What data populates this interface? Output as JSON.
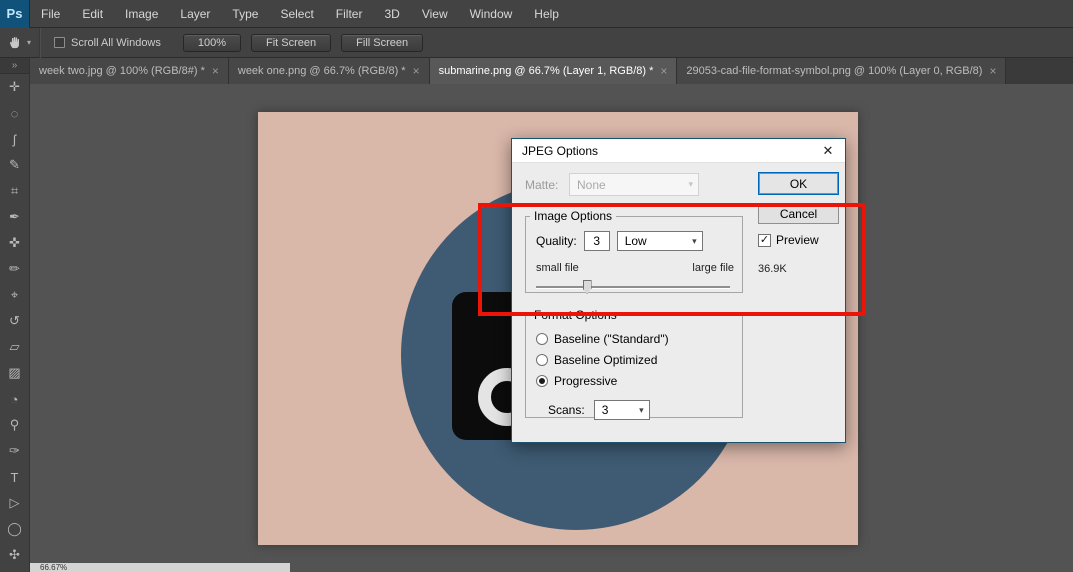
{
  "menu_bar": {
    "logo": "Ps",
    "items": [
      "File",
      "Edit",
      "Image",
      "Layer",
      "Type",
      "Select",
      "Filter",
      "3D",
      "View",
      "Window",
      "Help"
    ]
  },
  "options_bar": {
    "tool_icon": "hand-icon",
    "scroll_all_windows_label": "Scroll All Windows",
    "scroll_all_windows_checked": false,
    "buttons": [
      "100%",
      "Fit Screen",
      "Fill Screen"
    ]
  },
  "tabs": [
    {
      "label": "week two.jpg @ 100% (RGB/8#) *",
      "active": false
    },
    {
      "label": "week one.png @ 66.7% (RGB/8) *",
      "active": false
    },
    {
      "label": "submarine.png @ 66.7% (Layer 1, RGB/8) *",
      "active": true
    },
    {
      "label": "29053-cad-file-format-symbol.png @ 100% (Layer 0, RGB/8)",
      "active": false
    }
  ],
  "toolbar": {
    "tools": [
      {
        "name": "move",
        "glyph": "✛"
      },
      {
        "name": "marquee",
        "glyph": "◌"
      },
      {
        "name": "lasso",
        "glyph": "ʃ"
      },
      {
        "name": "quick-selection",
        "glyph": "✎"
      },
      {
        "name": "crop",
        "glyph": "⌗"
      },
      {
        "name": "eyedropper",
        "glyph": "✒"
      },
      {
        "name": "spot-healing",
        "glyph": "✜"
      },
      {
        "name": "brush",
        "glyph": "✏"
      },
      {
        "name": "clone-stamp",
        "glyph": "⌖"
      },
      {
        "name": "history-brush",
        "glyph": "↺"
      },
      {
        "name": "eraser",
        "glyph": "▱"
      },
      {
        "name": "gradient",
        "glyph": "▨"
      },
      {
        "name": "blur",
        "glyph": "◔"
      },
      {
        "name": "dodge",
        "glyph": "⚲"
      },
      {
        "name": "pen",
        "glyph": "✑"
      },
      {
        "name": "type",
        "glyph": "T"
      },
      {
        "name": "path-selection",
        "glyph": "▷"
      },
      {
        "name": "ellipse",
        "glyph": "◯"
      },
      {
        "name": "hand",
        "glyph": "✣"
      }
    ]
  },
  "status_bar": {
    "zoom": "66.67%"
  },
  "dialog": {
    "title": "JPEG Options",
    "matte_label": "Matte:",
    "matte_value": "None",
    "matte_disabled": true,
    "ok_label": "OK",
    "cancel_label": "Cancel",
    "image_options": {
      "legend": "Image Options",
      "quality_label": "Quality:",
      "quality_value": "3",
      "quality_name": "Low",
      "small_file": "small file",
      "large_file": "large file",
      "slider_percent": 24
    },
    "preview_label": "Preview",
    "preview_checked": true,
    "file_size": "36.9K",
    "format_options": {
      "legend": "Format Options",
      "radios": [
        {
          "label": "Baseline (\"Standard\")",
          "checked": false
        },
        {
          "label": "Baseline Optimized",
          "checked": false
        },
        {
          "label": "Progressive",
          "checked": true
        }
      ],
      "scans_label": "Scans:",
      "scans_value": "3"
    }
  },
  "ui": {
    "close_glyph": "✕",
    "tab_close_glyph": "×",
    "caret_down": "▾",
    "check_glyph": "✓",
    "panel_collapse": "»"
  },
  "colors": {
    "accent_blue": "#0067b8",
    "annotation_red": "#ea1508",
    "canvas_pink": "#d9b7a9",
    "circle_blue": "#3e5b73",
    "ps_logo_blue": "#10527a"
  }
}
